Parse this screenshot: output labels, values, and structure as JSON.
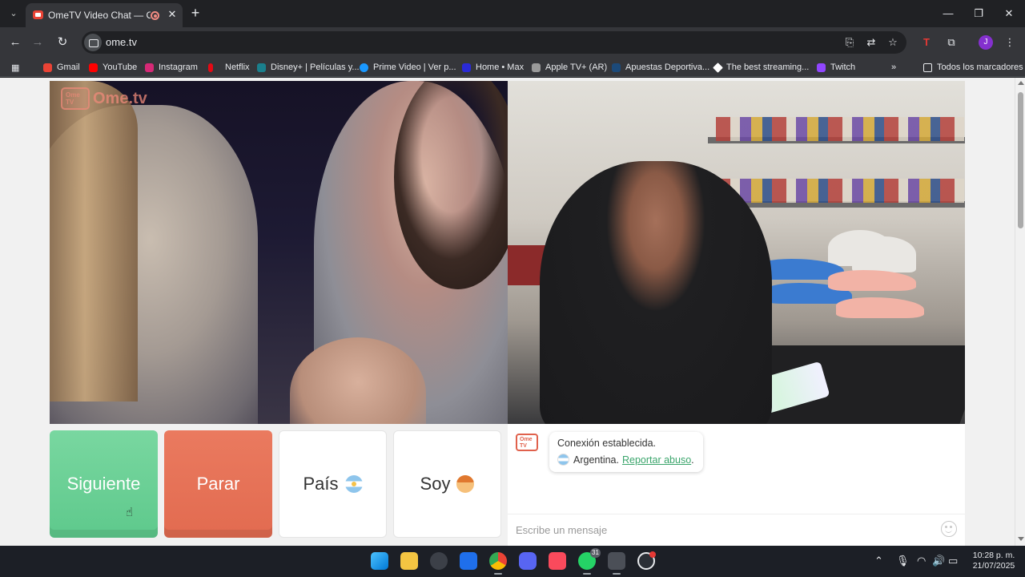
{
  "browser": {
    "tab_title": "OmeTV Video Chat — Ome",
    "tab_close": "✕",
    "new_tab": "+",
    "url": "ome.tv",
    "profile_initial": "J",
    "window_controls": {
      "minimize": "—",
      "maximize": "❐",
      "close": "✕"
    }
  },
  "bookmarks": [
    {
      "label": "Gmail",
      "icon": "gmail-icon",
      "color": "#ea4335"
    },
    {
      "label": "YouTube",
      "icon": "youtube-icon",
      "color": "#ff0000"
    },
    {
      "label": "Instagram",
      "icon": "instagram-icon",
      "color": "#d62976"
    },
    {
      "label": "Netflix",
      "icon": "netflix-icon",
      "color": "#e50914"
    },
    {
      "label": "Disney+ | Películas y...",
      "icon": "disney-icon",
      "color": "#1a7f8c"
    },
    {
      "label": "Prime Video | Ver p...",
      "icon": "prime-video-icon",
      "color": "#1a98ff"
    },
    {
      "label": "Home • Max",
      "icon": "max-icon",
      "color": "#2a2ad6"
    },
    {
      "label": "Apple TV+ (AR)",
      "icon": "appletv-icon",
      "color": "#9a9a9a"
    },
    {
      "label": "Apuestas Deportiva...",
      "icon": "bet-icon",
      "color": "#1c4a7a"
    },
    {
      "label": "The best streaming...",
      "icon": "streaming-icon",
      "color": "#ffffff"
    },
    {
      "label": "Twitch",
      "icon": "twitch-icon",
      "color": "#9146ff"
    }
  ],
  "bookmarks_overflow": "»",
  "all_bookmarks": "Todos los marcadores",
  "page": {
    "logo": {
      "badge": "Ome TV",
      "brand": "Ome.tv"
    },
    "buttons": {
      "next": "Siguiente",
      "stop": "Parar",
      "country": "País",
      "gender": "Soy"
    },
    "chat": {
      "logo_badge": "Ome TV",
      "status": "Conexión establecida.",
      "country": "Argentina.",
      "report": "Reportar abuso",
      "report_suffix": ".",
      "input_placeholder": "Escribe un mensaje"
    }
  },
  "taskbar": {
    "clock_time": "10:28 p. m.",
    "clock_date": "21/07/2025",
    "whatsapp_badge": "31"
  }
}
